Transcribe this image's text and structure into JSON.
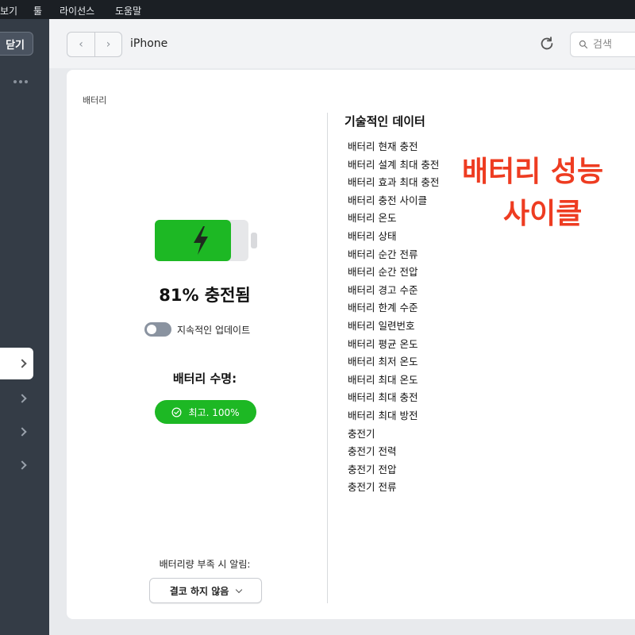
{
  "menubar": {
    "items": [
      "보기",
      "툴",
      "라이선스",
      "도움말"
    ]
  },
  "sidebar": {
    "close_label": "닫기"
  },
  "toolbar": {
    "back_label": "‹",
    "forward_label": "›",
    "device_title": "iPhone",
    "search_placeholder": "검색"
  },
  "battery": {
    "section_title": "배터리",
    "charge_percent": 81,
    "charge_text": "81% 충전됨",
    "toggle_label": "지속적인 업데이트",
    "toggle_on": false,
    "life_title": "배터리 수명:",
    "health_label": "최고. 100%",
    "alert_label": "배터리량 부족 시 알림:",
    "alert_value": "결코 하지 않음"
  },
  "tech": {
    "title": "기술적인 데이터",
    "items": [
      "배터리 현재 충전",
      "배터리 설계 최대 충전",
      "배터리 효과 최대 충전",
      "배터리 충전 사이클",
      "배터리 온도",
      "배터리 상태",
      "배터리 순간 전류",
      "배터리 순간 전압",
      "배터리 경고 수준",
      "배터리 한계 수준",
      "배터리 일련번호",
      "배터리 평균 온도",
      "배터리 최저 온도",
      "배터리 최대 온도",
      "배터리 최대 충전",
      "배터리 최대 방전",
      "충전기",
      "충전기 전력",
      "충전기 전압",
      "충전기 전류"
    ]
  },
  "overlay": {
    "line1": "배터리 성능",
    "line2": "사이클"
  },
  "colors": {
    "accent_green": "#1db824",
    "overlay_red": "#ee3c21"
  }
}
